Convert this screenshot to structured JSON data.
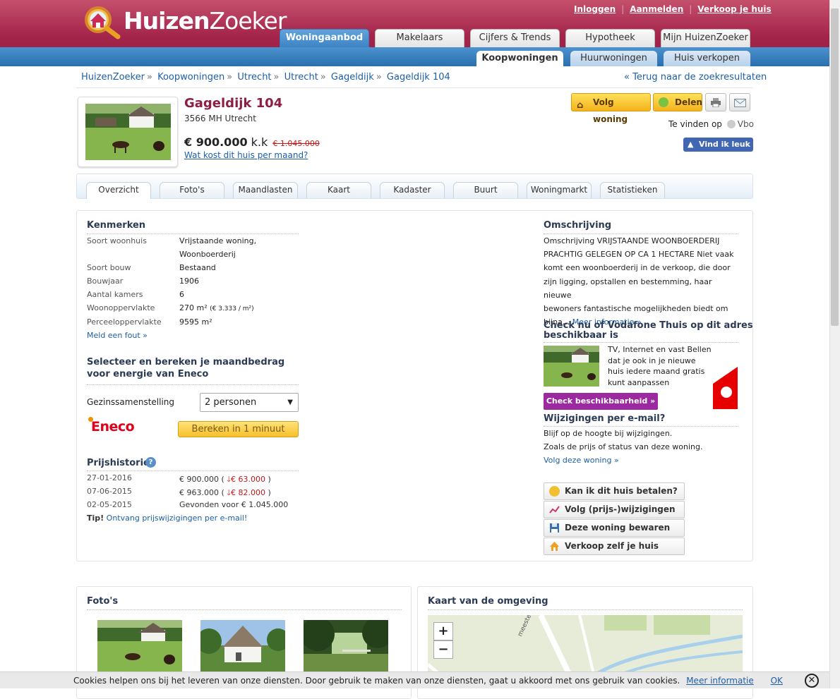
{
  "header": {
    "logo_part1": "Huizen",
    "logo_part2": "Zoeker",
    "links": [
      "Inloggen",
      "Aanmelden",
      "Verkoop je huis"
    ],
    "separator": "|",
    "main_tabs": [
      "Woningaanbod",
      "Makelaars",
      "Cijfers & Trends",
      "Hypotheek",
      "Mijn HuizenZoeker"
    ],
    "sub_tabs": [
      "Koopwoningen",
      "Huurwoningen",
      "Huis verkopen"
    ]
  },
  "breadcrumb": {
    "items": [
      "HuizenZoeker",
      "Koopwoningen",
      "Utrecht",
      "Utrecht",
      "Gageldijk",
      "Gageldijk 104"
    ],
    "separator": "»",
    "back": "« Terug naar de zoekresultaten"
  },
  "property": {
    "title": "Gageldijk 104",
    "address": "3566 MH Utrecht",
    "price": "€ 900.000",
    "price_suffix": "k.k",
    "old_price": "€ 1.045.000",
    "monthly_link": "Wat kost dit huis per maand?",
    "follow_label": "Volg woning",
    "share_label": "Delen",
    "found_on": "Te vinden op",
    "found_source": "Vbo",
    "fb_like": "Vind ik leuk 0"
  },
  "tabs": [
    "Overzicht",
    "Foto's",
    "Maandlasten",
    "Kaart",
    "Kadaster",
    "Buurt",
    "Woningmarkt",
    "Statistieken"
  ],
  "kenmerken": {
    "title": "Kenmerken",
    "rows": [
      {
        "label": "Soort woonhuis",
        "value": "Vrijstaande woning,",
        "value2": "Woonboerderij"
      },
      {
        "label": "Soort bouw",
        "value": "Bestaand"
      },
      {
        "label": "Bouwjaar",
        "value": "1906"
      },
      {
        "label": "Aantal kamers",
        "value": "6"
      },
      {
        "label": "Woonoppervlakte",
        "value": "270 m²",
        "extra": "(€ 3.333 / m²)"
      },
      {
        "label": "Perceeloppervlakte",
        "value": "9595 m²"
      }
    ],
    "report_link": "Meld een fout »"
  },
  "energy": {
    "title_line1": "Selecteer en bereken je maandbedrag",
    "title_line2": "voor energie van Eneco",
    "label": "Gezinssamenstelling",
    "selected": "2 personen",
    "brand": "Eneco",
    "button": "Bereken in 1 minuut"
  },
  "price_history": {
    "title": "Prijshistorie",
    "rows": [
      {
        "date": "27-01-2016",
        "price": "€ 900.000",
        "change": "€ 63.000"
      },
      {
        "date": "07-06-2015",
        "price": "€ 963.000",
        "change": "€ 82.000"
      },
      {
        "date": "02-05-2015",
        "text": "Gevonden voor € 1.045.000"
      }
    ],
    "tip_label": "Tip!",
    "tip_link": "Ontvang prijswijzigingen per e-mail!"
  },
  "omschrijving": {
    "title": "Omschrijving",
    "lines": [
      "Omschrijving VRIJSTAANDE WOONBOERDERIJ",
      "PRACHTIG GELEGEN OP CA 1 HECTARE Niet vaak",
      "komt een woonboerderij in de verkoop, die door",
      "zijn ligging, opstallen en bestemming, haar nieuwe",
      "bewoners fantastische mogelijkheden biedt om",
      "bijna..."
    ],
    "more_link": "Meer informatie »"
  },
  "vodafone": {
    "title_line1": "Check nu of Vodafone Thuis op dit adres",
    "title_line2": "beschikbaar is",
    "text": "TV, Internet en vast Bellen dat je ook in je nieuwe huis iedere maand gratis kunt aanpassen",
    "button": "Check beschikbaarheid »"
  },
  "email_updates": {
    "title": "Wijzigingen per e-mail?",
    "line1": "Blijf op de hoogte bij wijzigingen.",
    "line2": "Zoals de prijs of status van deze woning.",
    "link": "Volg deze woning »"
  },
  "actions": [
    "Kan ik dit huis betalen?",
    "Volg (prijs-)wijzigingen",
    "Deze woning bewaren",
    "Verkoop zelf je huis"
  ],
  "fotos_title": "Foto's",
  "kaart": {
    "title": "Kaart van de omgeving",
    "zoom_in": "+",
    "zoom_out": "−",
    "street": "meester Huydecope"
  },
  "cookie": {
    "text": "Cookies helpen ons bij het leveren van onze diensten. Door gebruik te maken van onze diensten, gaat u akkoord met ons gebruik van cookies.",
    "more": "Meer informatie",
    "ok": "OK",
    "close": "✕"
  },
  "colors": {
    "brand": "#a4244a",
    "blue": "#2a6fae",
    "link": "#1d5fa6",
    "price_drop": "#c01818"
  }
}
